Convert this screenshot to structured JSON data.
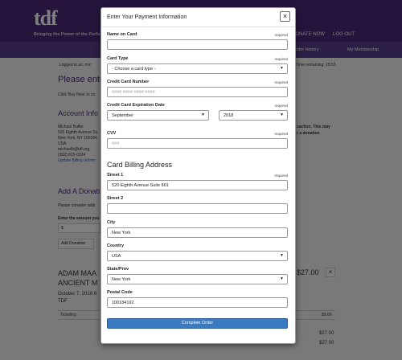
{
  "background": {
    "logo": "tdf",
    "tagline": "Bringing the Power of the Perfor",
    "nav_donate": "DONATE NOW",
    "nav_logout": "LOG OUT",
    "sub_order_history": "Order History",
    "sub_membership": "My Membership",
    "logged_in": "Logged in as: mic",
    "time_remaining": "Time remaining: 15:53",
    "heading": "Please ente",
    "click_buy": "Click 'Buy Now' to co",
    "account_heading": "Account Info",
    "account_lines": [
      "Michael Buffer",
      "520 Eighth Avenue Su",
      "New York, NY 100184",
      "USA",
      "michaelb@tdf.org",
      "(302) 815-0324",
      "Update Billing Inform"
    ],
    "right_note_1": "saction. This may",
    "right_note_2": "r a donation",
    "donation_heading": "Add A Donati",
    "donation_note": "Please consider addi",
    "amount_label": "Enter the amount you",
    "amount_value": "$",
    "add_donation": "Add Donation",
    "event_title_1": "ADAM MAA",
    "event_title_2": "ANCIENT M",
    "event_date": "October 7, 2018 8",
    "event_venue": "TDF",
    "event_price": "$27.00",
    "ticketing": "Ticketing",
    "ticketing_price": "$9.00",
    "subtotal_1": "$27.00",
    "subtotal_2": "$27.00"
  },
  "modal": {
    "title": "Enter Your Payment Information",
    "close": "×",
    "required_text": "required",
    "fields": {
      "name_on_card": {
        "label": "Name on Card",
        "value": ""
      },
      "card_type": {
        "label": "Card Type",
        "value": "- Choose a card type -"
      },
      "card_number": {
        "label": "Credit Card Number",
        "placeholder": "#### #### #### ####"
      },
      "expiration": {
        "label": "Credit Card Expiration Date",
        "month": "September",
        "year": "2018"
      },
      "cvv": {
        "label": "CVV",
        "placeholder": "###"
      }
    },
    "billing_heading": "Card Billing Address",
    "address": {
      "street1": {
        "label": "Street 1",
        "value": "520 Eighth Avenue Suite 801"
      },
      "street2": {
        "label": "Street 2",
        "value": ""
      },
      "city": {
        "label": "City",
        "value": "New York"
      },
      "country": {
        "label": "Country",
        "value": "USA"
      },
      "state": {
        "label": "State/Prov",
        "value": "New York"
      },
      "postal": {
        "label": "Postal Code",
        "value": "100184192"
      }
    },
    "submit_label": "Complete Order"
  }
}
